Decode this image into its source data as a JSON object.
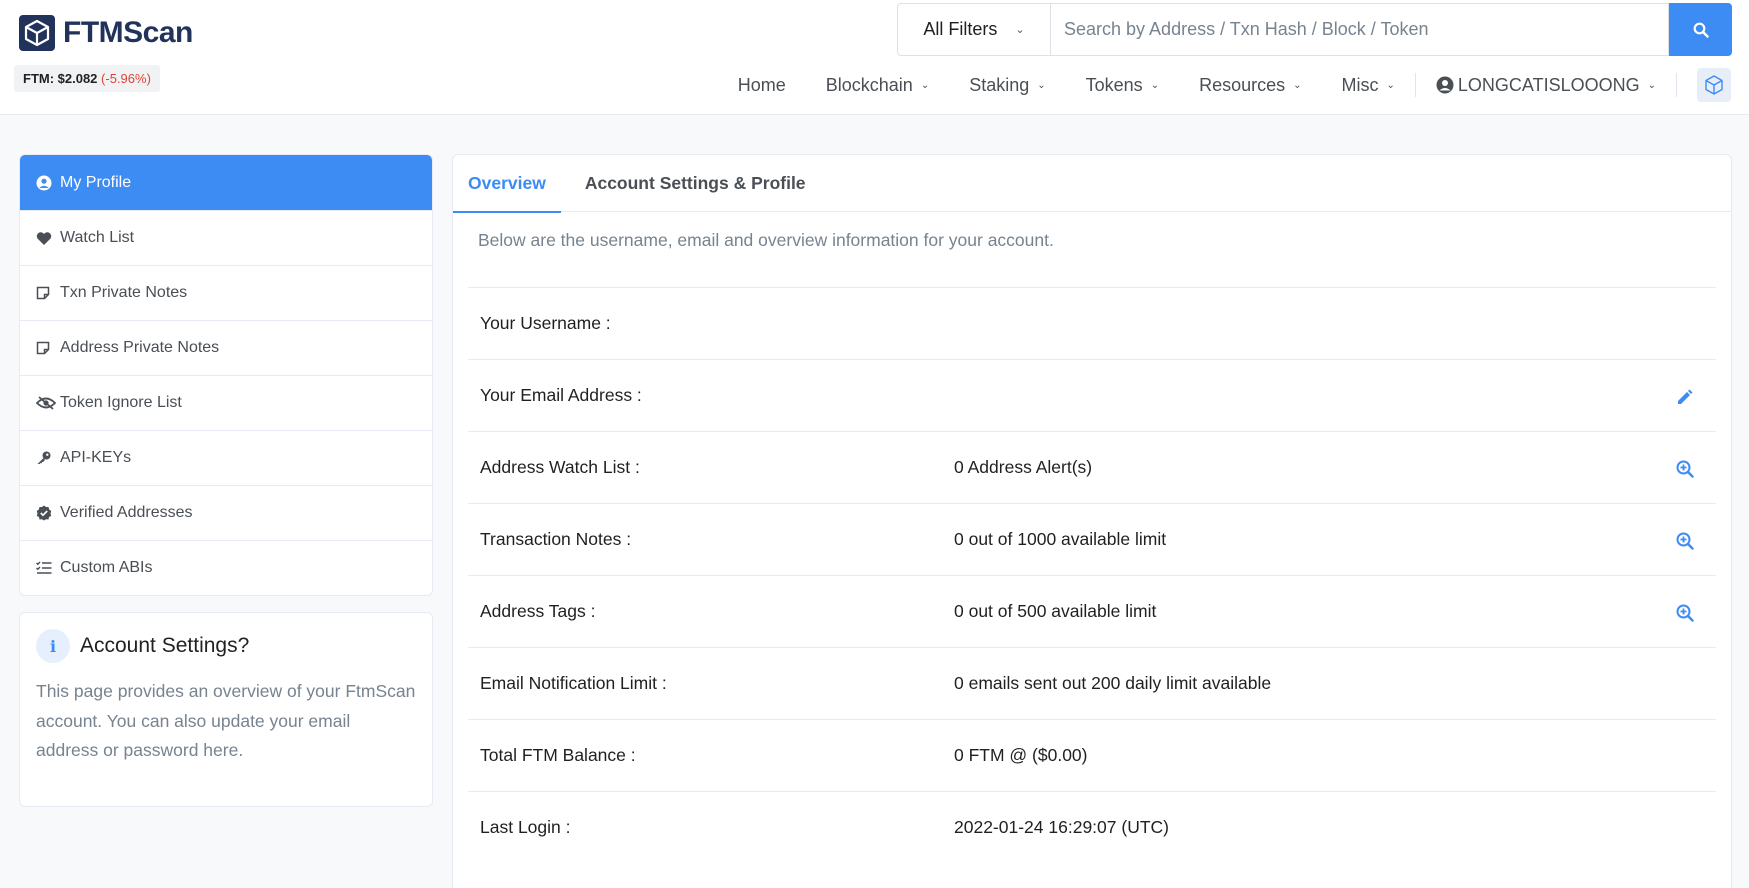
{
  "brand": {
    "name": "FTMScan",
    "price_label": "FTM: $2.082",
    "price_change": "(-5.96%)"
  },
  "search": {
    "filter": "All Filters",
    "placeholder": "Search by Address / Txn Hash / Block / Token"
  },
  "nav": {
    "items": [
      "Home",
      "Blockchain",
      "Staking",
      "Tokens",
      "Resources",
      "Misc"
    ],
    "user": "LONGCATISLOOONG"
  },
  "sidebar": {
    "items": [
      {
        "label": "My Profile",
        "icon": "user-circle-icon",
        "active": true
      },
      {
        "label": "Watch List",
        "icon": "heart-icon"
      },
      {
        "label": "Txn Private Notes",
        "icon": "note-icon"
      },
      {
        "label": "Address Private Notes",
        "icon": "note-icon"
      },
      {
        "label": "Token Ignore List",
        "icon": "eye-slash-icon"
      },
      {
        "label": "API-KEYs",
        "icon": "key-icon"
      },
      {
        "label": "Verified Addresses",
        "icon": "badge-check-icon"
      },
      {
        "label": "Custom ABIs",
        "icon": "list-check-icon"
      }
    ]
  },
  "info": {
    "title": "Account Settings?",
    "text": "This page provides an overview of your FtmScan account. You can also update your email address or password here."
  },
  "main": {
    "tabs": [
      "Overview",
      "Account Settings & Profile"
    ],
    "intro": "Below are the username, email and overview information for your account.",
    "rows": [
      {
        "key": "Your Username :",
        "value": ""
      },
      {
        "key": "Your Email Address :",
        "value": "",
        "action": "edit-icon"
      },
      {
        "key": "Address Watch List :",
        "value": "0 Address Alert(s)",
        "action": "zoom-icon"
      },
      {
        "key": "Transaction Notes :",
        "value": "0 out of 1000 available limit",
        "action": "zoom-icon"
      },
      {
        "key": "Address Tags :",
        "value": "0 out of 500 available limit",
        "action": "zoom-icon"
      },
      {
        "key": "Email Notification Limit :",
        "value": "0 emails sent out 200 daily limit available"
      },
      {
        "key": "Total FTM Balance :",
        "value": "0 FTM @ ($0.00)"
      },
      {
        "key": "Last Login :",
        "value": "2022-01-24 16:29:07 (UTC)"
      }
    ]
  },
  "colors": {
    "primary": "#3c8cf3",
    "brand": "#21325b",
    "negative": "#de4437"
  }
}
